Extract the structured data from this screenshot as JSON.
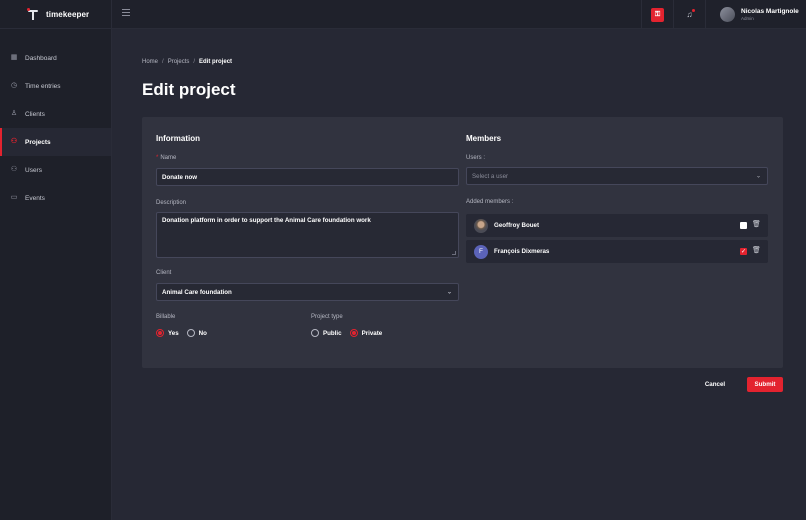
{
  "app": {
    "name": "timekeeper"
  },
  "sidebar": {
    "items": [
      {
        "label": "Dashboard",
        "icon": "dashboard-icon",
        "active": false
      },
      {
        "label": "Time entries",
        "icon": "clock-icon",
        "active": false
      },
      {
        "label": "Clients",
        "icon": "user-icon",
        "active": false
      },
      {
        "label": "Projects",
        "icon": "projects-icon",
        "active": true
      },
      {
        "label": "Users",
        "icon": "users-icon",
        "active": false
      },
      {
        "label": "Events",
        "icon": "calendar-icon",
        "active": false
      }
    ]
  },
  "topbar": {
    "user": {
      "name": "Nicolas Martignole",
      "role": "Admin"
    }
  },
  "breadcrumb": {
    "home": "Home",
    "projects": "Projects",
    "current": "Edit project"
  },
  "page": {
    "title": "Edit project"
  },
  "form": {
    "information_title": "Information",
    "name": {
      "label": "Name",
      "value": "Donate now"
    },
    "description": {
      "label": "Description",
      "value": "Donation platform in order to support the Animal Care foundation work"
    },
    "client": {
      "label": "Client",
      "value": "Animal Care foundation"
    },
    "billable": {
      "label": "Billable",
      "yes": "Yes",
      "no": "No",
      "selected": "Yes"
    },
    "project_type": {
      "label": "Project type",
      "public": "Public",
      "private": "Private",
      "selected": "Private"
    }
  },
  "members": {
    "title": "Members",
    "users_label": "Users :",
    "select_placeholder": "Select a user",
    "added_label": "Added members :",
    "list": [
      {
        "name": "Geoffroy Bouet",
        "avatar": "photo",
        "checked": false
      },
      {
        "name": "François Dixmeras",
        "avatar": "F",
        "checked": true
      }
    ]
  },
  "actions": {
    "cancel": "Cancel",
    "submit": "Submit"
  },
  "colors": {
    "accent": "#e3232f",
    "background": "#262834",
    "card": "#31333f",
    "sidebar": "#1e2029"
  }
}
